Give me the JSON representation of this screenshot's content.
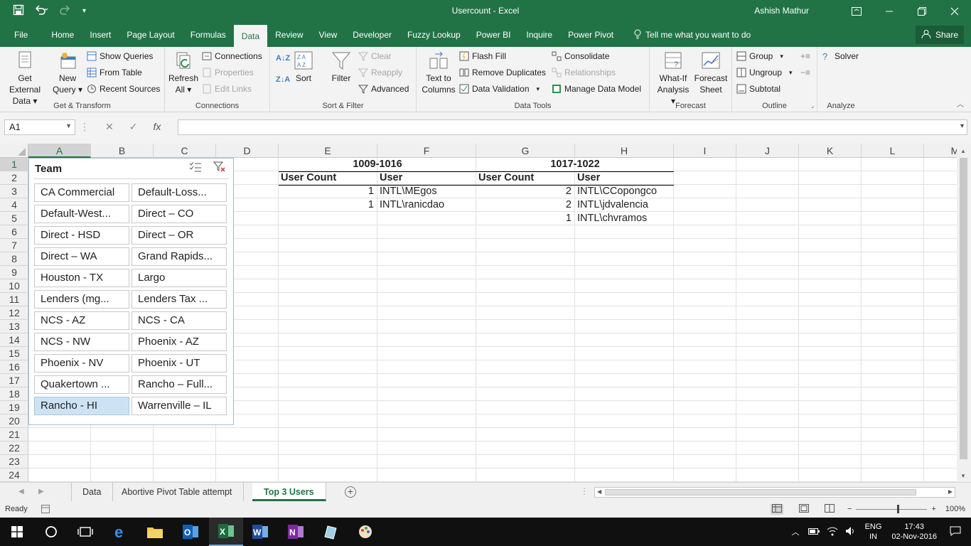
{
  "window": {
    "title": "Usercount - Excel",
    "user": "Ashish Mathur",
    "share_label": "Share"
  },
  "menu_tabs": [
    "File",
    "Home",
    "Insert",
    "Page Layout",
    "Formulas",
    "Data",
    "Review",
    "View",
    "Developer",
    "Fuzzy Lookup",
    "Power BI",
    "Inquire",
    "Power Pivot"
  ],
  "active_tab": "Data",
  "tell_me": "Tell me what you want to do",
  "ribbon": {
    "get_external": [
      "Get External",
      "Data ▾"
    ],
    "new_query": [
      "New",
      "Query ▾"
    ],
    "show_queries": "Show Queries",
    "from_table": "From Table",
    "recent_sources": "Recent Sources",
    "group_get_transform": "Get & Transform",
    "refresh_all": [
      "Refresh",
      "All ▾"
    ],
    "connections": "Connections",
    "properties": "Properties",
    "edit_links": "Edit Links",
    "group_connections": "Connections",
    "sort": "Sort",
    "filter": "Filter",
    "clear": "Clear",
    "reapply": "Reapply",
    "advanced": "Advanced",
    "group_sort_filter": "Sort & Filter",
    "text_to_columns": [
      "Text to",
      "Columns"
    ],
    "flash_fill": "Flash Fill",
    "remove_duplicates": "Remove Duplicates",
    "data_validation": "Data Validation",
    "consolidate": "Consolidate",
    "relationships": "Relationships",
    "manage_data_model": "Manage Data Model",
    "group_data_tools": "Data Tools",
    "what_if": [
      "What-If",
      "Analysis ▾"
    ],
    "forecast_sheet": [
      "Forecast",
      "Sheet"
    ],
    "group_forecast": "Forecast",
    "group": "Group",
    "ungroup": "Ungroup",
    "subtotal": "Subtotal",
    "group_outline": "Outline",
    "solver": "Solver",
    "group_analyze": "Analyze"
  },
  "formula_bar": {
    "name_box": "A1",
    "cancel": "✕",
    "enter": "✓",
    "fx": "fx",
    "formula": ""
  },
  "columns": [
    "A",
    "B",
    "C",
    "D",
    "E",
    "F",
    "G",
    "H",
    "I",
    "J",
    "K",
    "L",
    "M"
  ],
  "rows": [
    "1",
    "2",
    "3",
    "4",
    "5",
    "6",
    "7",
    "8",
    "9",
    "10",
    "11",
    "12",
    "13",
    "14",
    "15",
    "16",
    "17",
    "18",
    "19",
    "20",
    "21",
    "22",
    "23",
    "24"
  ],
  "sheet": {
    "e1": "1009-1016",
    "g1": "1017-1022",
    "e2": "User Count",
    "f2": "User",
    "g2": "User Count",
    "h2": "User",
    "e3": "1",
    "f3": "INTL\\MEgos",
    "e4": "1",
    "f4": "INTL\\ranicdao",
    "g3": "2",
    "h3": "INTL\\CCopongco",
    "g4": "2",
    "h4": "INTL\\jdvalencia",
    "g5": "1",
    "h5": "INTL\\chvramos"
  },
  "slicer": {
    "title": "Team",
    "items": [
      "CA Commercial",
      "Default-Loss...",
      "Default-West...",
      "Direct – CO",
      "Direct - HSD",
      "Direct – OR",
      "Direct – WA",
      "Grand Rapids...",
      "Houston - TX",
      "Largo",
      "Lenders (mg...",
      "Lenders Tax ...",
      "NCS - AZ",
      "NCS - CA",
      "NCS - NW",
      "Phoenix - AZ",
      "Phoenix - NV",
      "Phoenix - UT",
      "Quakertown ...",
      "Rancho – Full...",
      "Rancho - HI",
      "Warrenville – IL"
    ],
    "selected": "Rancho - HI"
  },
  "sheet_tabs": [
    "Data",
    "Abortive Pivot Table attempt",
    "Top 3 Users"
  ],
  "active_sheet": "Top 3 Users",
  "status": {
    "ready": "Ready",
    "zoom": "100%"
  },
  "taskbar": {
    "lang1": "ENG",
    "lang2": "IN",
    "time": "17:43",
    "date": "02-Nov-2016"
  },
  "colors": {
    "excel_green": "#217346",
    "slicer_selected": "#cde3f4"
  }
}
